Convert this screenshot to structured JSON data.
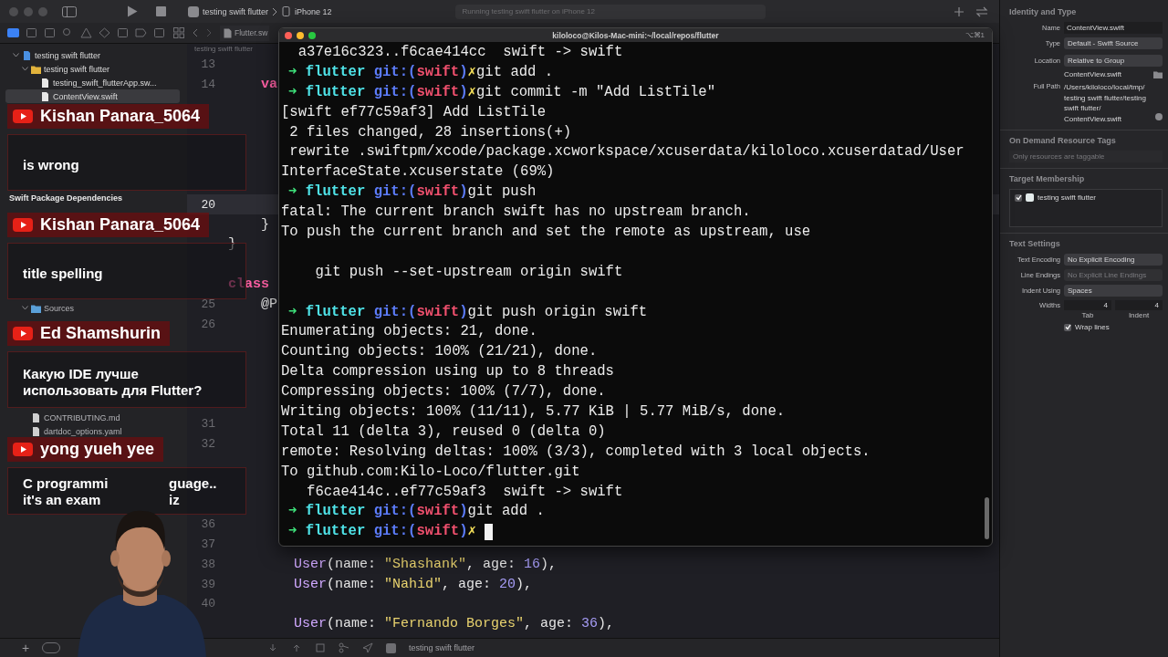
{
  "toolbar": {
    "scheme": "testing swift flutter",
    "device": "iPhone 12",
    "status": "Running testing swift flutter on iPhone 12"
  },
  "nav_tabs": [
    {
      "kind": "project",
      "selected": true
    },
    {
      "kind": "source",
      "selected": false
    },
    {
      "kind": "symbol",
      "selected": false
    },
    {
      "kind": "search",
      "selected": false
    },
    {
      "kind": "issue",
      "selected": false
    },
    {
      "kind": "test",
      "selected": false
    },
    {
      "kind": "debug",
      "selected": false
    },
    {
      "kind": "breakpoint",
      "selected": false
    },
    {
      "kind": "report",
      "selected": false
    }
  ],
  "editor_tab": "Flutter.sw",
  "breadcrumb": "testing swift flutter",
  "navigator": {
    "tree": [
      {
        "name": "testing swift flutter",
        "kind": "project",
        "expanded": true,
        "selected": false,
        "children": [
          {
            "name": "testing swift flutter",
            "kind": "group",
            "expanded": true,
            "selected": false,
            "children": [
              {
                "name": "testing_swift_flutterApp.sw...",
                "kind": "swift",
                "selected": false
              },
              {
                "name": "ContentView.swift",
                "kind": "swift",
                "selected": true
              }
            ]
          }
        ]
      }
    ],
    "packages_header": "Swift Package Dependencies",
    "packages": [
      {
        "name": "Sources",
        "kind": "folder",
        "expanded": true,
        "selected": false
      },
      {
        "name": "CONTRIBUTING.md",
        "kind": "file",
        "selected": false
      },
      {
        "name": "dartdoc_options.yaml",
        "kind": "file",
        "selected": false
      }
    ],
    "footer_add": "+"
  },
  "editor_lines": [
    {
      "number": "13",
      "current": false
    },
    {
      "number": "14",
      "current": false,
      "code": [
        {
          "kind": "keyword",
          "text": "    va"
        }
      ]
    },
    {
      "current": false
    },
    {
      "current": false
    },
    {
      "current": false
    },
    {
      "current": false
    },
    {
      "current": false
    },
    {
      "number": "20",
      "current": true
    },
    {
      "current": false,
      "code": [
        {
          "kind": "plain",
          "text": "    }"
        }
      ]
    },
    {
      "current": false,
      "code": [
        {
          "kind": "plain",
          "text": "}"
        }
      ]
    },
    {
      "current": false
    },
    {
      "current": false,
      "code": [
        {
          "kind": "keyword",
          "text": "class"
        }
      ]
    },
    {
      "number": "25",
      "current": false,
      "code": [
        {
          "kind": "plain",
          "text": "    @P"
        }
      ]
    },
    {
      "number": "26",
      "current": false
    },
    {
      "current": false
    },
    {
      "current": false
    },
    {
      "current": false
    },
    {
      "current": false
    },
    {
      "number": "31",
      "current": false
    },
    {
      "number": "32",
      "current": false
    },
    {
      "current": false
    },
    {
      "current": false
    },
    {
      "current": false
    },
    {
      "number": "36",
      "current": false
    },
    {
      "number": "37",
      "current": false
    },
    {
      "number": "38",
      "current": false,
      "code": [
        {
          "kind": "type",
          "text": "        User"
        },
        {
          "kind": "plain",
          "text": "(name: "
        },
        {
          "kind": "string",
          "text": "\"Shashank\""
        },
        {
          "kind": "plain",
          "text": ", age: "
        },
        {
          "kind": "number",
          "text": "16"
        },
        {
          "kind": "plain",
          "text": "),"
        }
      ]
    },
    {
      "number": "39",
      "current": false,
      "code": [
        {
          "kind": "type",
          "text": "        User"
        },
        {
          "kind": "plain",
          "text": "(name: "
        },
        {
          "kind": "string",
          "text": "\"Nahid\""
        },
        {
          "kind": "plain",
          "text": ", age: "
        },
        {
          "kind": "number",
          "text": "20"
        },
        {
          "kind": "plain",
          "text": "),"
        }
      ]
    },
    {
      "number": "40",
      "current": false
    },
    {
      "current": false,
      "code": [
        {
          "kind": "type",
          "text": "        User"
        },
        {
          "kind": "plain",
          "text": "(name: "
        },
        {
          "kind": "string",
          "text": "\"Fernando Borges\""
        },
        {
          "kind": "plain",
          "text": ", age: "
        },
        {
          "kind": "number",
          "text": "36"
        },
        {
          "kind": "plain",
          "text": "),"
        }
      ]
    }
  ],
  "editor_footer": "testing swift flutter",
  "inspector": {
    "identity_title": "Identity and Type",
    "name_label": "Name",
    "name_value": "ContentView.swift",
    "type_label": "Type",
    "type_value": "Default - Swift Source",
    "location_label": "Location",
    "location_value": "Relative to Group",
    "location_file": "ContentView.swift",
    "path_label": "Full Path",
    "path": "/Users/kiloloco/local/tmp/testing swift flutter/testing swift flutter/ContentView.swift",
    "tags_title": "On Demand Resource Tags",
    "tags_placeholder": "Only resources are taggable",
    "membership_title": "Target Membership",
    "membership": [
      {
        "name": "testing swift flutter",
        "checked": true
      }
    ],
    "text_title": "Text Settings",
    "selects": [
      {
        "label": "Text Encoding",
        "value": "No Explicit Encoding",
        "disabled": false
      },
      {
        "label": "Line Endings",
        "value": "No Explicit Line Endings",
        "disabled": true
      },
      {
        "label": "Indent Using",
        "value": "Spaces",
        "disabled": false
      }
    ],
    "widths_label": "Widths",
    "tab_value": "4",
    "tab_label": "Tab",
    "indent_value": "4",
    "indent_label": "Indent",
    "wrap": {
      "label": "Wrap lines",
      "checked": true
    }
  },
  "terminal": {
    "title": "kiloloco@Kilos-Mac-mini:~/local/repos/flutter",
    "shortcut": "⌥⌘1",
    "lines": [
      {
        "kind": "output",
        "text": "  a37e16c323..f6cae414cc  swift -> swift"
      },
      {
        "kind": "prompt",
        "arrow": "➜",
        "dir": "flutter",
        "git_open": "git:(",
        "branch": "swift",
        "git_close": ")",
        "dirty": "✗",
        "command": "git add ."
      },
      {
        "kind": "prompt",
        "arrow": "➜",
        "dir": "flutter",
        "git_open": "git:(",
        "branch": "swift",
        "git_close": ")",
        "dirty": "✗",
        "command": "git commit -m \"Add ListTile\""
      },
      {
        "kind": "output",
        "text": "[swift ef77c59af3] Add ListTile"
      },
      {
        "kind": "output",
        "text": " 2 files changed, 28 insertions(+)"
      },
      {
        "kind": "output",
        "text": " rewrite .swiftpm/xcode/package.xcworkspace/xcuserdata/kiloloco.xcuserdatad/User"
      },
      {
        "kind": "output",
        "text": "InterfaceState.xcuserstate (69%)"
      },
      {
        "kind": "prompt",
        "arrow": "➜",
        "dir": "flutter",
        "git_open": "git:(",
        "branch": "swift",
        "git_close": ")",
        "command": "git push"
      },
      {
        "kind": "output",
        "text": "fatal: The current branch swift has no upstream branch."
      },
      {
        "kind": "output",
        "text": "To push the current branch and set the remote as upstream, use"
      },
      {
        "kind": "blank"
      },
      {
        "kind": "output",
        "text": "    git push --set-upstream origin swift"
      },
      {
        "kind": "blank"
      },
      {
        "kind": "prompt",
        "arrow": "➜",
        "dir": "flutter",
        "git_open": "git:(",
        "branch": "swift",
        "git_close": ")",
        "command": "git push origin swift"
      },
      {
        "kind": "output",
        "text": "Enumerating objects: 21, done."
      },
      {
        "kind": "output",
        "text": "Counting objects: 100% (21/21), done."
      },
      {
        "kind": "output",
        "text": "Delta compression using up to 8 threads"
      },
      {
        "kind": "output",
        "text": "Compressing objects: 100% (7/7), done."
      },
      {
        "kind": "output",
        "text": "Writing objects: 100% (11/11), 5.77 KiB | 5.77 MiB/s, done."
      },
      {
        "kind": "output",
        "text": "Total 11 (delta 3), reused 0 (delta 0)"
      },
      {
        "kind": "output",
        "text": "remote: Resolving deltas: 100% (3/3), completed with 3 local objects."
      },
      {
        "kind": "output",
        "text": "To github.com:Kilo-Loco/flutter.git"
      },
      {
        "kind": "output",
        "text": "   f6cae414c..ef77c59af3  swift -> swift"
      },
      {
        "kind": "prompt",
        "arrow": "➜",
        "dir": "flutter",
        "git_open": "git:(",
        "branch": "swift",
        "git_close": ")",
        "command": "git add ."
      },
      {
        "kind": "prompt",
        "arrow": "➜",
        "dir": "flutter",
        "git_open": "git:(",
        "branch": "swift",
        "git_close": ")",
        "dirty": "✗",
        "cursor": true
      }
    ]
  },
  "chat": [
    {
      "author": "Kishan Panara_5064",
      "text_lines": [
        [
          "is wrong"
        ]
      ]
    },
    {
      "author": "Kishan Panara_5064",
      "text_lines": [
        [
          "title spelling"
        ]
      ]
    },
    {
      "author": "Ed Shamshurin",
      "text_lines": [
        [
          "Какую IDE лучше"
        ],
        [
          "использовать для Flutter?"
        ]
      ]
    },
    {
      "author": "yong yueh yee",
      "text_lines": [
        [
          "C programmi",
          "guage.."
        ],
        [
          "it's an exam",
          "iz"
        ]
      ]
    }
  ]
}
